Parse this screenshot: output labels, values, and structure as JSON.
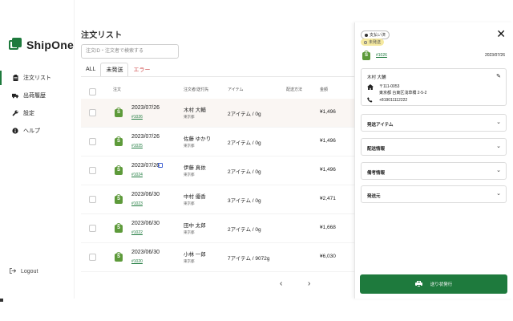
{
  "app": {
    "name": "ShipOne",
    "brand_color": "#1e7a3d"
  },
  "sidebar": {
    "items": [
      {
        "label": "注文リスト",
        "icon": "clipboard-icon",
        "active": true
      },
      {
        "label": "出荷履歴",
        "icon": "truck-icon",
        "active": false
      },
      {
        "label": "設定",
        "icon": "wrench-icon",
        "active": false
      },
      {
        "label": "ヘルプ",
        "icon": "info-icon",
        "active": false
      }
    ],
    "logout_label": "Logout"
  },
  "main": {
    "title": "注文リスト",
    "search_placeholder": "注文ID・注文者で検索する",
    "tabs": [
      {
        "label": "ALL"
      },
      {
        "label": "未発送"
      },
      {
        "label": "エラー"
      }
    ],
    "columns": {
      "shop": "注文",
      "recipient": "注文者/送付先",
      "items": "アイテム",
      "method": "配送方法",
      "amount": "金額"
    },
    "rows": [
      {
        "date": "2023/07/26",
        "order": "#1026",
        "name": "木村 大輔",
        "pref": "東京都",
        "items": "2アイテム / 0g",
        "amount": "¥1,496",
        "selected": true,
        "memo": false
      },
      {
        "date": "2023/07/26",
        "order": "#1025",
        "name": "佐藤 ゆかり",
        "pref": "東京都",
        "items": "2アイテム / 0g",
        "amount": "¥1,496",
        "selected": false,
        "memo": false
      },
      {
        "date": "2023/07/26",
        "order": "#1024",
        "name": "伊藤 真依",
        "pref": "東京都",
        "items": "2アイテム / 0g",
        "amount": "¥1,496",
        "selected": false,
        "memo": true
      },
      {
        "date": "2023/06/30",
        "order": "#1023",
        "name": "中村 優香",
        "pref": "東京都",
        "items": "3アイテム / 0g",
        "amount": "¥2,471",
        "selected": false,
        "memo": false
      },
      {
        "date": "2023/06/30",
        "order": "#1022",
        "name": "田中 太郎",
        "pref": "東京都",
        "items": "2アイテム / 0g",
        "amount": "¥1,668",
        "selected": false,
        "memo": false
      },
      {
        "date": "2023/06/30",
        "order": "#1020",
        "name": "小林 一郎",
        "pref": "東京都",
        "items": "7アイテム / 9072g",
        "amount": "¥6,030",
        "selected": false,
        "memo": false
      }
    ],
    "pager": {
      "prev": "‹",
      "next": "›"
    }
  },
  "panel": {
    "payment_badge": "支払い済",
    "shipping_badge": "未発送",
    "order": "#1026",
    "date": "2023/07/26",
    "customer": {
      "name": "木村 大輔",
      "zip": "〒111-0053",
      "address": "東京都 台東区浅草橋 2-5-2",
      "phone": "+819011112222"
    },
    "sections": [
      {
        "label": "発送アイテム"
      },
      {
        "label": "配送情報"
      },
      {
        "label": "備考情報"
      },
      {
        "label": "発送元"
      }
    ],
    "print_label": "送り状発行"
  }
}
